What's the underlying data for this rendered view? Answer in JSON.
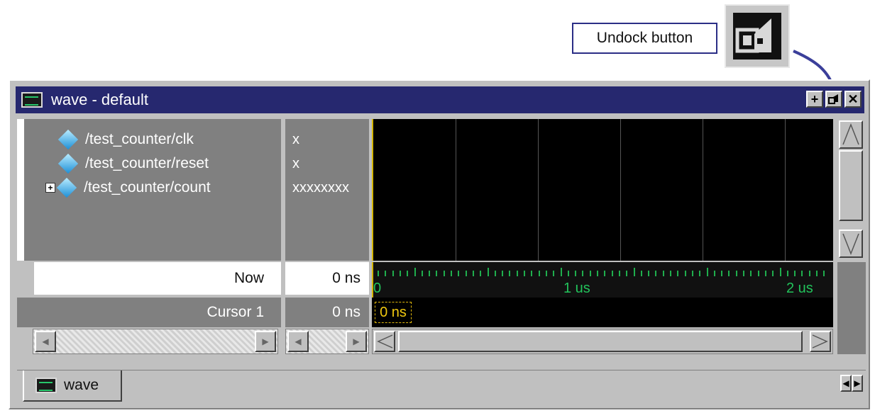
{
  "callout": {
    "label": "Undock button"
  },
  "window": {
    "title": "wave - default",
    "buttons": {
      "add_icon": "plus-icon",
      "undock_icon": "undock-icon",
      "close_icon": "close-icon"
    }
  },
  "signals": [
    {
      "name": "/test_counter/clk",
      "value": "x"
    },
    {
      "name": "/test_counter/reset",
      "value": "x"
    },
    {
      "name": "/test_counter/count",
      "value": "xxxxxxxx"
    }
  ],
  "now": {
    "label": "Now",
    "value": "0 ns"
  },
  "cursor": {
    "label": "Cursor 1",
    "value": "0 ns",
    "marker": "0 ns"
  },
  "timeline": {
    "labels": [
      "0",
      "1 us",
      "2 us"
    ]
  },
  "tabs": [
    {
      "label": "wave"
    }
  ],
  "colors": {
    "titlebar": "#26286f",
    "wave_bg": "#000000",
    "timeline_green": "#22c35b",
    "cursor_yellow": "#f0c810"
  }
}
